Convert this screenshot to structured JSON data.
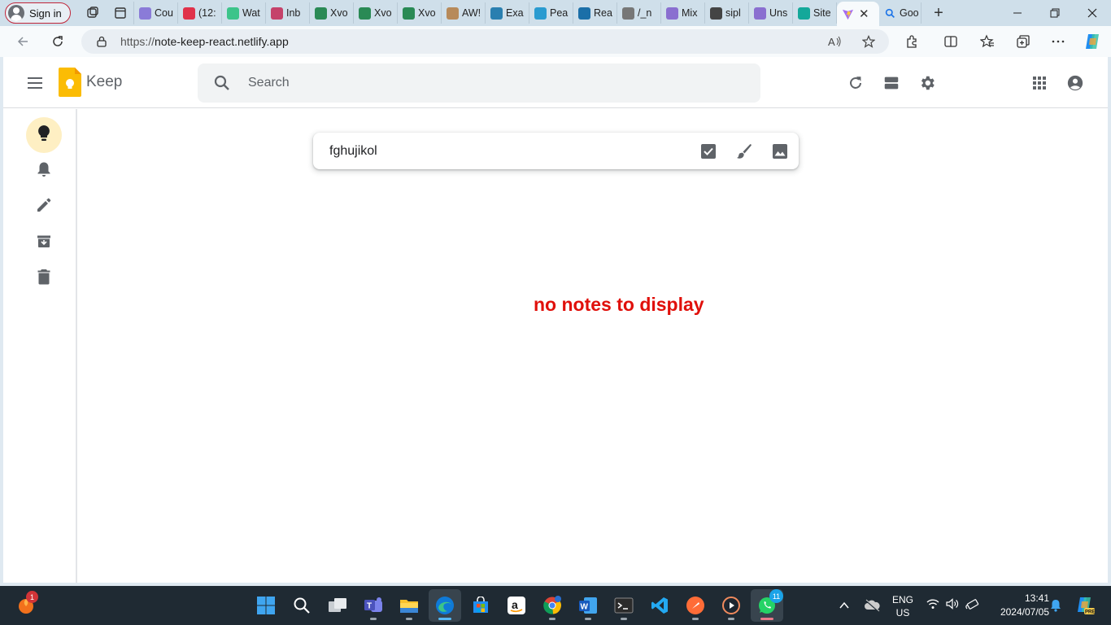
{
  "browser": {
    "sign_in_label": "Sign in",
    "tabs": [
      {
        "label": "Cou",
        "icon": "course-tab-icon",
        "color": "#8a7bd8"
      },
      {
        "label": "(12:",
        "icon": "youtube-tab-icon",
        "color": "#e0324a"
      },
      {
        "label": "Wat",
        "icon": "play-tab-icon",
        "color": "#3cc48a"
      },
      {
        "label": "Inb",
        "icon": "gmail-tab-icon",
        "color": "#c5426a"
      },
      {
        "label": "Xvo",
        "icon": "xvo-tab-icon",
        "color": "#2a8a55"
      },
      {
        "label": "Xvo",
        "icon": "xvo-tab-icon",
        "color": "#2a8a55"
      },
      {
        "label": "Xvo",
        "icon": "xvo-tab-icon",
        "color": "#2a8a55"
      },
      {
        "label": "AW!",
        "icon": "box-tab-icon",
        "color": "#b78a5a"
      },
      {
        "label": "Exa",
        "icon": "drop-tab-icon",
        "color": "#2a7fb0"
      },
      {
        "label": "Pea",
        "icon": "p-tab-icon",
        "color": "#2a9bd0"
      },
      {
        "label": "Rea",
        "icon": "r-tab-icon",
        "color": "#1b6fa8"
      },
      {
        "label": "/_n",
        "icon": "page-tab-icon",
        "color": "#777777"
      },
      {
        "label": "Mix",
        "icon": "vite-tab-icon",
        "color": "#8a6fd0"
      },
      {
        "label": "sipl",
        "icon": "github-tab-icon",
        "color": "#444444"
      },
      {
        "label": "Uns",
        "icon": "vite-tab-icon",
        "color": "#8a6fd0"
      },
      {
        "label": "Site",
        "icon": "netlify-tab-icon",
        "color": "#14a89a"
      }
    ],
    "active_tab_icon": "vite-tab-icon",
    "after_tab": {
      "label": "Goo",
      "icon": "search-tab-icon",
      "color": "#1a73e8"
    },
    "url_protocol": "https://",
    "url_host": "note-keep-react.netlify.app"
  },
  "app": {
    "brand": "Keep",
    "search_placeholder": "Search",
    "note_input_text": "fghujikol",
    "empty_message": "no notes to display",
    "accent_color": "#fbbc04",
    "empty_message_color": "#e0100b"
  },
  "taskbar": {
    "language_line1": "ENG",
    "language_line2": "US",
    "time": "13:41",
    "date": "2024/07/05",
    "notification_badge": "1",
    "whatsapp_badge": "11"
  }
}
